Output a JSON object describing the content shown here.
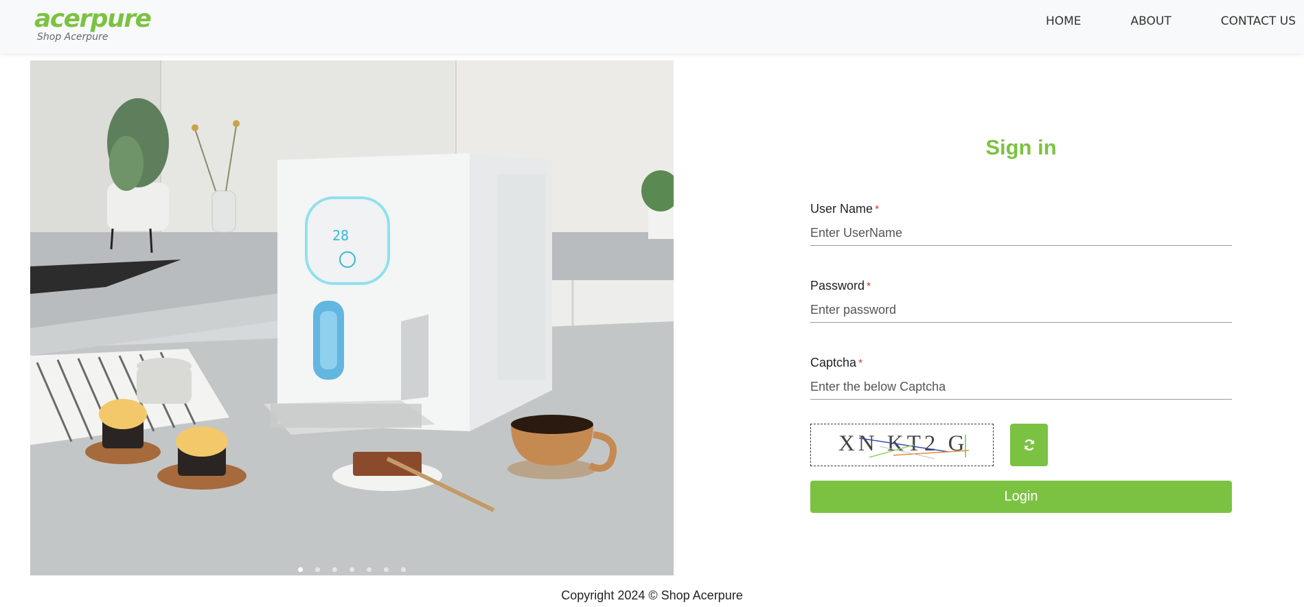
{
  "brand": {
    "name": "acerpure",
    "tagline": "Shop Acerpure",
    "accent_color": "#7cc242"
  },
  "nav": {
    "items": [
      {
        "label": "HOME"
      },
      {
        "label": "ABOUT"
      },
      {
        "label": "CONTACT US"
      }
    ]
  },
  "hero": {
    "image_icon": "product-photo-water-dispenser",
    "dispenser_display": "28",
    "slide_count": 7,
    "active_slide": 1
  },
  "signin": {
    "title": "Sign in",
    "username": {
      "label": "User Name",
      "required_mark": "*",
      "placeholder": "Enter UserName",
      "value": ""
    },
    "password": {
      "label": "Password",
      "required_mark": "*",
      "placeholder": "Enter password",
      "value": ""
    },
    "captcha": {
      "label": "Captcha",
      "required_mark": "*",
      "placeholder": "Enter the below Captcha",
      "value": "",
      "image_text": "XN KT2 G",
      "refresh_icon": "refresh-icon"
    },
    "login_label": "Login"
  },
  "footer": {
    "copyright": "Copyright 2024 © Shop Acerpure"
  }
}
